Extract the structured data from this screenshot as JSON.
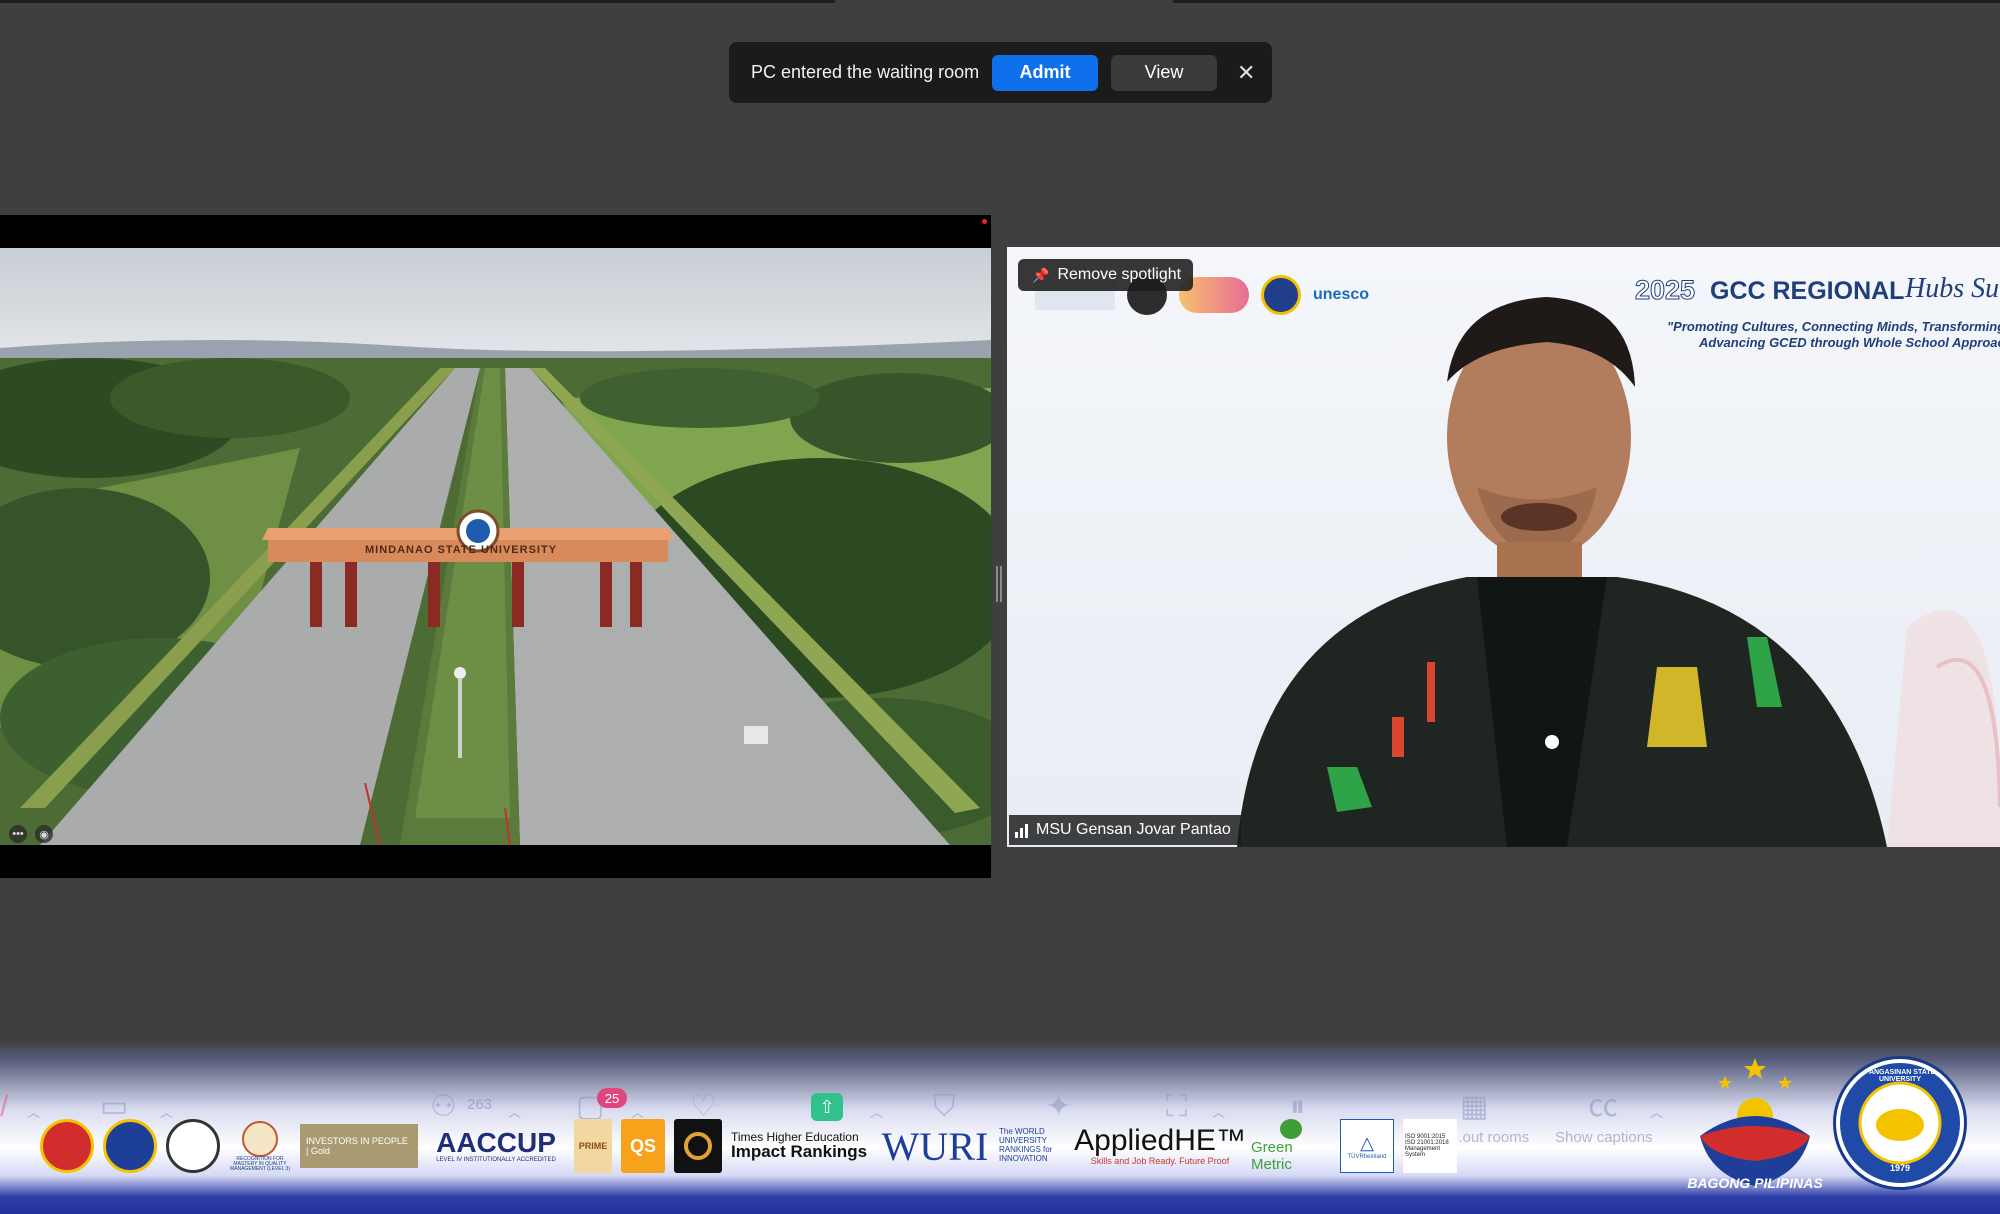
{
  "notification": {
    "message": "PC entered the waiting room",
    "admit_label": "Admit",
    "view_label": "View",
    "close_glyph": "✕"
  },
  "left_tile": {
    "gate_text": "MINDANAO STATE UNIVERSITY",
    "more_glyph": "•••"
  },
  "right_tile": {
    "spotlight_label": "Remove spotlight",
    "participant_name": "MSU Gensan Jovar Pantao",
    "slide": {
      "year": "2025",
      "title": "GCC REGIONAL",
      "script_title": "Hubs Su",
      "tagline_1": "\"Promoting Cultures, Connecting Minds, Transforming F",
      "tagline_2": "Advancing GCED through Whole School Approach\"",
      "partner_unesco": "unesco"
    }
  },
  "toolbar": {
    "participants_count": "263",
    "chat_badge": "25",
    "breakout_label": "...out rooms",
    "captions_label": "Show captions",
    "icons": [
      "mute-icon",
      "video-icon",
      "participants-icon",
      "chat-icon",
      "react-icon",
      "share-icon",
      "security-icon",
      "ai-companion-icon",
      "apps-icon",
      "pause-recording-icon",
      "breakout-rooms-icon",
      "captions-icon"
    ]
  },
  "banner": {
    "logo_investors": "INVESTORS IN PEOPLE | Gold",
    "logo_aaccup": "AACCUP",
    "logo_aaccup_sub": "LEVEL IV INSTITUTIONALLY ACCREDITED",
    "logo_prime": "PRIME",
    "logo_qs": "QS",
    "logo_the_1": "Times Higher Education",
    "logo_the_2": "Impact Rankings",
    "logo_wuri": "WURI",
    "logo_wuri_text": "The WORLD UNIVERSITY RANKINGS for INNOVATION",
    "logo_applied": "AppliedHE™",
    "logo_applied_sub": "Skills and Job Ready. Future Proof",
    "logo_ui_green": "Green Metric",
    "logo_tuv": "TÜVRheinland",
    "logo_iso": "ISO 9001:2015 ISO 21001:2018 Management System",
    "logo_recognition": "RECOGNITION FOR MASTERY IN QUALITY MANAGEMENT (LEVEL 3)",
    "bagong_pilipinas": "BAGONG PILIPINAS",
    "psu_seal": "PANGASINAN STATE UNIVERSITY",
    "psu_year": "1979"
  },
  "colors": {
    "admit_blue": "#0e71eb",
    "share_green": "#30c28a",
    "badge_pink": "#e0467c",
    "slide_navy": "#1f3e7a"
  }
}
